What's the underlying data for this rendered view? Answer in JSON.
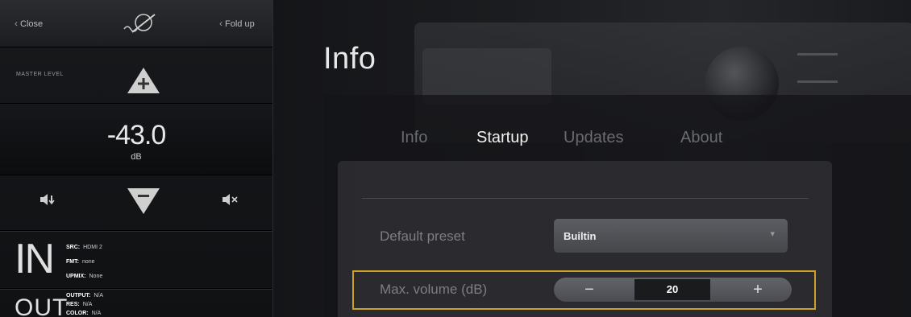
{
  "left_panel": {
    "close_label": "Close",
    "fold_label": "Fold up",
    "master_level_label": "MASTER LEVEL",
    "volume_value": "-43.0",
    "volume_unit": "dB",
    "input_letters": "IN",
    "input_sub": "",
    "output_letters": "OUT",
    "input_info": [
      {
        "key": "SRC:",
        "value": "HDMI 2"
      },
      {
        "key": "FMT:",
        "value": "none"
      },
      {
        "key": "UPMIX:",
        "value": "None"
      }
    ],
    "output_info": [
      {
        "key": "OUTPUT:",
        "value": "N/A"
      },
      {
        "key": "RES:",
        "value": "N/A"
      },
      {
        "key": "COLOR:",
        "value": "N/A"
      }
    ]
  },
  "main": {
    "title": "Info",
    "tabs": [
      {
        "label": "Info",
        "active": false
      },
      {
        "label": "Startup",
        "active": true
      },
      {
        "label": "Updates",
        "active": false
      },
      {
        "label": "About",
        "active": false
      }
    ],
    "default_preset_label": "Default preset",
    "default_preset_value": "Builtin",
    "max_volume_label": "Max. volume (dB)",
    "max_volume_value": "20",
    "minus_label": "−",
    "plus_label": "+"
  },
  "colors": {
    "highlight": "#c9a227",
    "accent_text": "#f0f0f0"
  }
}
